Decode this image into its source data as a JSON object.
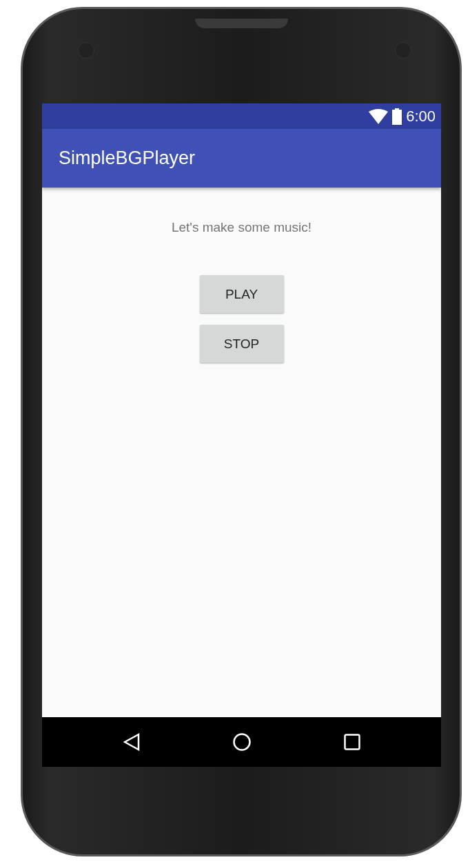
{
  "status_bar": {
    "time": "6:00"
  },
  "app_bar": {
    "title": "SimpleBGPlayer"
  },
  "message": "Let's make some music!",
  "buttons": [
    {
      "label": "PLAY"
    },
    {
      "label": "STOP"
    }
  ]
}
